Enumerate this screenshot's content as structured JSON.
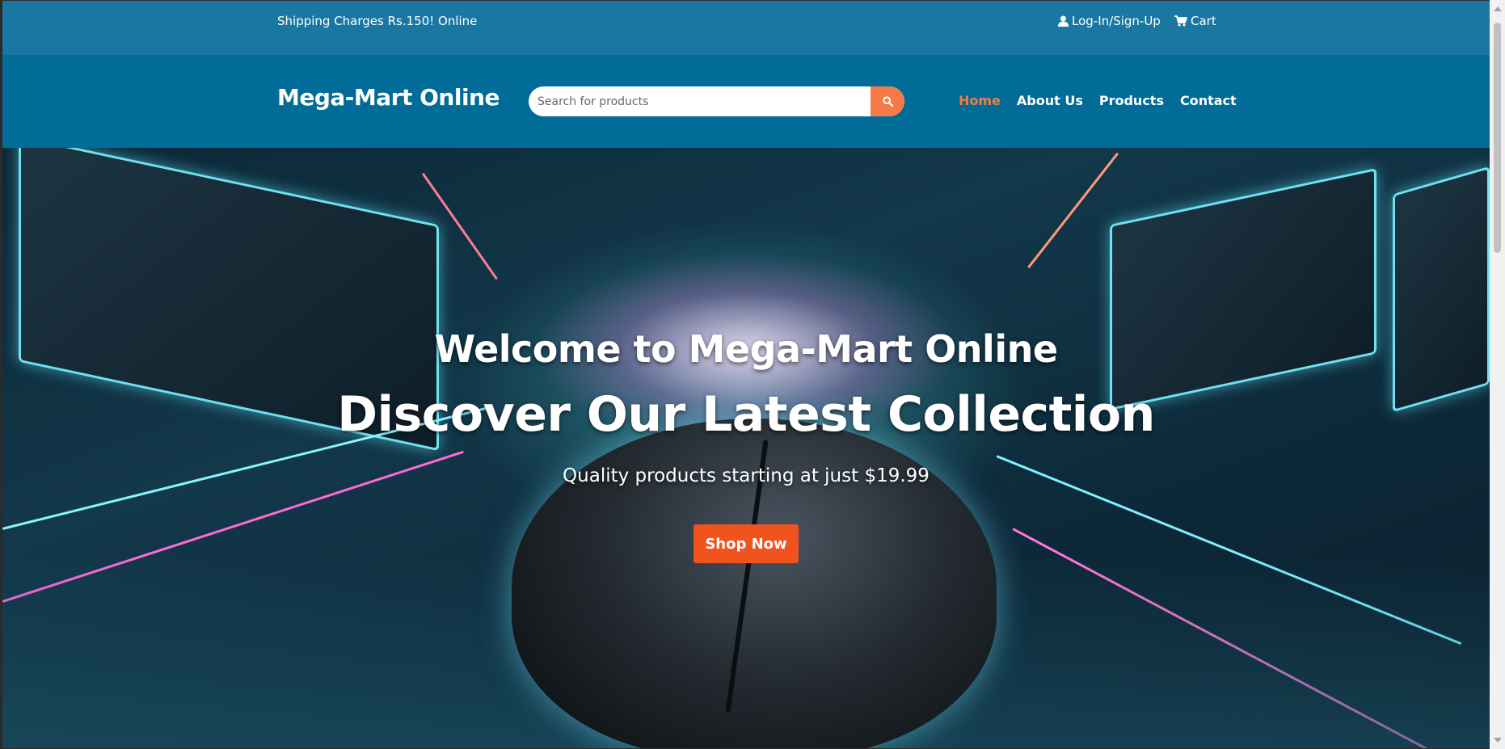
{
  "topbar": {
    "shipping_text": "Shipping Charges Rs.150! Online",
    "login_label": "Log-In/Sign-Up",
    "cart_label": "Cart",
    "login_icon": "user-icon",
    "cart_icon": "cart-icon"
  },
  "header": {
    "logo": "Mega-Mart Online",
    "search_placeholder": "Search for products",
    "search_icon": "search-icon",
    "nav": [
      {
        "label": "Home",
        "active": true
      },
      {
        "label": "About Us",
        "active": false
      },
      {
        "label": "Products",
        "active": false
      },
      {
        "label": "Contact",
        "active": false
      }
    ]
  },
  "hero": {
    "welcome": "Welcome to Mega-Mart Online",
    "headline": "Discover Our Latest Collection",
    "subtext": "Quality products starting at just $19.99",
    "cta_label": "Shop Now"
  },
  "colors": {
    "topbar_bg": "#1a77a1",
    "header_bg": "#016c97",
    "accent": "#f57a45",
    "cta_bg": "#f0531e"
  }
}
